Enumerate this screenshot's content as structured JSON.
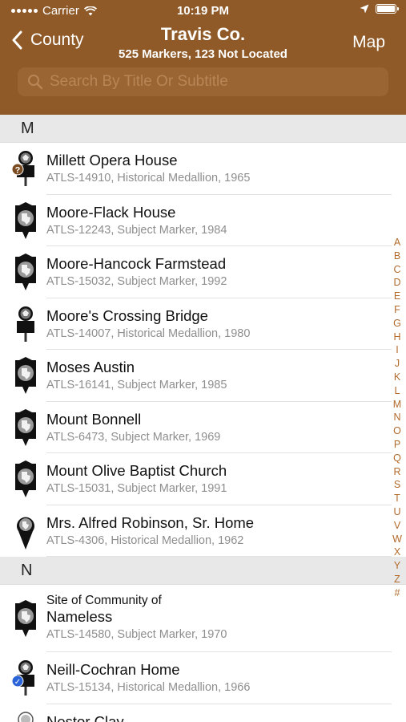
{
  "status_bar": {
    "carrier": "Carrier",
    "time": "10:19 PM"
  },
  "nav": {
    "back_label": "County",
    "title": "Travis Co.",
    "subtitle": "525 Markers, 123 Not Located",
    "map_label": "Map"
  },
  "search": {
    "placeholder": "Search By Title Or Subtitle"
  },
  "sections": [
    {
      "letter": "M",
      "rows": [
        {
          "title": "Millett Opera House",
          "subtitle": "ATLS-14910, Historical Medallion, 1965",
          "icon": "medallion-not-located-icon",
          "badge": "?"
        },
        {
          "title": "Moore-Flack House",
          "subtitle": "ATLS-12243, Subject Marker, 1984",
          "icon": "subject-marker-icon"
        },
        {
          "title": "Moore-Hancock Farmstead",
          "subtitle": "ATLS-15032, Subject Marker, 1992",
          "icon": "subject-marker-icon"
        },
        {
          "title": "Moore's Crossing Bridge",
          "subtitle": "ATLS-14007, Historical Medallion, 1980",
          "icon": "medallion-icon"
        },
        {
          "title": "Moses Austin",
          "subtitle": "ATLS-16141, Subject Marker, 1985",
          "icon": "subject-marker-icon"
        },
        {
          "title": "Mount Bonnell",
          "subtitle": "ATLS-6473, Subject Marker, 1969",
          "icon": "subject-marker-icon"
        },
        {
          "title": "Mount Olive Baptist Church",
          "subtitle": "ATLS-15031, Subject Marker, 1991",
          "icon": "subject-marker-icon"
        },
        {
          "title": "Mrs. Alfred Robinson, Sr. Home",
          "subtitle": "ATLS-4306, Historical Medallion, 1962",
          "icon": "map-pin-icon"
        }
      ]
    },
    {
      "letter": "N",
      "rows": [
        {
          "pretitle": "Site of Community of",
          "title": "Nameless",
          "subtitle": "ATLS-14580, Subject Marker, 1970",
          "icon": "subject-marker-icon"
        },
        {
          "title": "Neill-Cochran Home",
          "subtitle": "ATLS-15134, Historical Medallion, 1966",
          "icon": "medallion-visited-icon",
          "badge": "✓"
        },
        {
          "title": "Nestor Clay",
          "subtitle": "",
          "icon": "medallion-icon"
        }
      ]
    }
  ],
  "index_letters": [
    "A",
    "B",
    "C",
    "D",
    "E",
    "F",
    "G",
    "H",
    "I",
    "J",
    "K",
    "L",
    "M",
    "N",
    "O",
    "P",
    "Q",
    "R",
    "S",
    "T",
    "U",
    "V",
    "W",
    "X",
    "Y",
    "Z",
    "#"
  ],
  "colors": {
    "header": "#8f5a28",
    "index": "#b26a2a",
    "badge_question": "#7a4a20",
    "badge_check": "#2b63d9"
  }
}
